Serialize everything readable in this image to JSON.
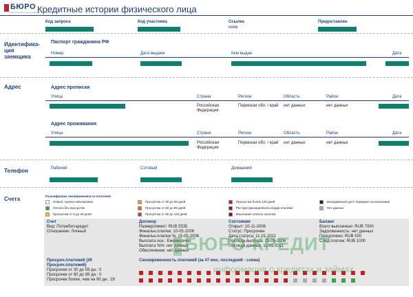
{
  "header": {
    "logo_text": "БЮРО",
    "logo_sub": "национальное бюро кредитных историй",
    "title": "Кредитные истории физического лица"
  },
  "request": {
    "fields": [
      {
        "label": "Код запроса",
        "value": ""
      },
      {
        "label": "Код участника",
        "value": ""
      },
      {
        "label": "Ссылка",
        "value": "none"
      },
      {
        "label": "Предоставлен",
        "value": ""
      }
    ]
  },
  "identification": {
    "section": "Идентифика-ция заемщика",
    "passport_title": "Паспорт гражданина РФ",
    "columns": [
      "Номер",
      "Дата выдачи",
      "Кем выдан",
      "Дата"
    ]
  },
  "address": {
    "section": "Адрес",
    "registration_title": "Адрес прописки",
    "residence_title": "Адрес проживания",
    "columns": [
      "Улица",
      "Страна",
      "Регион",
      "Область",
      "Район",
      "Дата"
    ],
    "registration_row": {
      "country": "Российская Федерация",
      "region": "Пермская обл. / край",
      "oblast": "нет данных",
      "district": "нет данных"
    },
    "residence_row": {
      "country": "Российская Федерация",
      "region": "Пермская обл. / край",
      "oblast": "нет данных",
      "district": "нет данных"
    }
  },
  "phone": {
    "section": "Телефон",
    "columns": [
      "Рабочий",
      "Сотовый",
      "Домашний"
    ]
  },
  "accounts": {
    "section": "Счета",
    "legend_title": "Расшифровка своевременности платежей",
    "legend": [
      {
        "text": "Новый, оценка невозможна",
        "color": "#ffffff"
      },
      {
        "text": "Оплата без просрочек",
        "color": "#3aa04a"
      },
      {
        "text": "Просрочка от 6 до 29 дней",
        "color": "#e8c020"
      },
      {
        "text": "Просрочка от 30 до 59 дней",
        "color": "#e89a20"
      },
      {
        "text": "Просрочка от 60 до 89 дней",
        "color": "#e06a20"
      },
      {
        "text": "Просрочка от 90 до 119 дней",
        "color": "#d04020"
      },
      {
        "text": "Просрочка более 120 дней",
        "color": "#c02020"
      },
      {
        "text": "Реструктуризация/консолидир.платежи",
        "color": "#7a2020"
      },
      {
        "text": "Взыскание оплаты залогом",
        "color": "#8a1010"
      },
      {
        "text": "Безнадёжный долг/ передано на взыскание",
        "color": "#222222"
      },
      {
        "text": "Нет данных",
        "color": "#aaaaaa"
      }
    ],
    "account": {
      "title": "Счет",
      "type": "Вид: Потребит.кредит",
      "relation": "Отношение: Личный"
    },
    "contract": {
      "title": "Договор",
      "lines": [
        "Размер/лимит: RUB 5535",
        "Финальн.платеж: 10-05-2006",
        "Финальн.платеж %: 15-05-2006",
        "Выплата осн.: Ежемесячно",
        "Выплата %%: нет данных",
        "Обеспечение: нет данных"
      ]
    },
    "status": {
      "title": "Состояние",
      "lines": [
        "Открыт: 10-11-2006",
        "Статус: Просрочен",
        "Дата статуса: 11-01-2011",
        "Последн.выплата: 25-05-2006",
        "Последн.данные: 11-01-2011"
      ]
    },
    "balance": {
      "title": "Баланс",
      "lines": [
        "Всего выплачено: RUB 7000",
        "Задолженность: нет данных",
        "Просрочено: RUB 500",
        "След.платеж: RUB 1000"
      ]
    },
    "overdue": {
      "title": "Просроч.платежей (29 Просроч.платежей)",
      "lines": [
        "Просрочек от 30 до 59 дн.: 0",
        "Просрочек от 60 до 89 дн.: 0",
        "Просрочек более, чем на 90 дн.: 29"
      ]
    },
    "timeliness_title": "Своевременность платежей (за 47 мес, последний - слева)",
    "watermark_main": "БЮРО КРЕДИТ",
    "watermark_sub": "информация о кредитах и займах"
  }
}
